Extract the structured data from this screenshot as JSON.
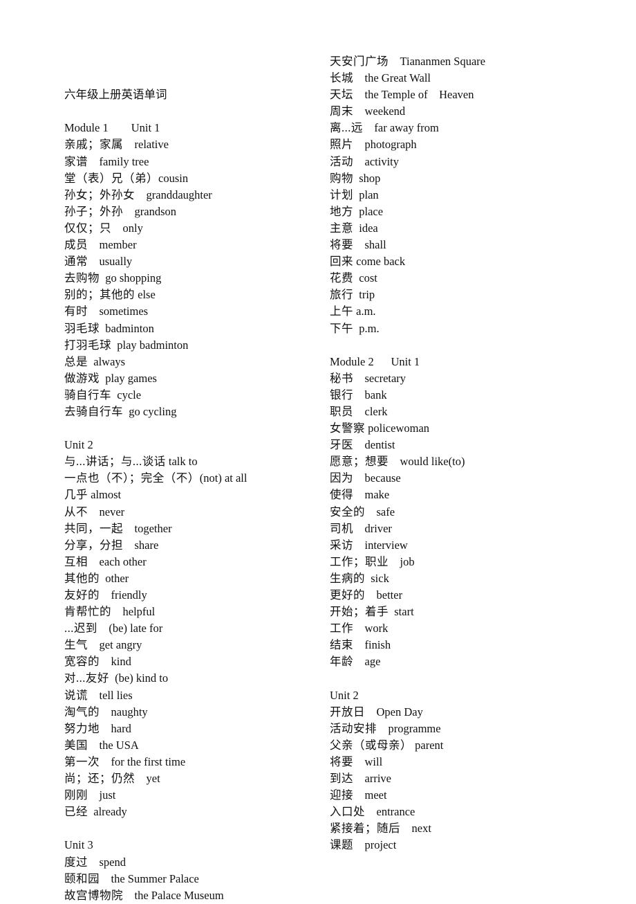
{
  "document": {
    "title": "六年级上册英语单词",
    "left_column": [
      {
        "type": "heading",
        "text": "Module 1        Unit 1"
      },
      {
        "type": "entry",
        "zh": "亲戚；家属",
        "sep": "    ",
        "en": "relative"
      },
      {
        "type": "entry",
        "zh": "家谱",
        "sep": "    ",
        "en": "family tree"
      },
      {
        "type": "entry",
        "zh": "堂（表）兄（弟）",
        "sep": "",
        "en": "cousin"
      },
      {
        "type": "entry",
        "zh": "孙女；外孙女",
        "sep": "    ",
        "en": "granddaughter"
      },
      {
        "type": "entry",
        "zh": "孙子；外孙",
        "sep": "    ",
        "en": "grandson"
      },
      {
        "type": "entry",
        "zh": "仅仅；只",
        "sep": "    ",
        "en": "only"
      },
      {
        "type": "entry",
        "zh": "成员",
        "sep": "    ",
        "en": "member"
      },
      {
        "type": "entry",
        "zh": "通常",
        "sep": "    ",
        "en": "usually"
      },
      {
        "type": "entry",
        "zh": "去购物",
        "sep": "  ",
        "en": "go shopping"
      },
      {
        "type": "entry",
        "zh": "别的；其他的",
        "sep": " ",
        "en": "else"
      },
      {
        "type": "entry",
        "zh": "有时",
        "sep": "    ",
        "en": "sometimes"
      },
      {
        "type": "entry",
        "zh": "羽毛球",
        "sep": "  ",
        "en": "badminton"
      },
      {
        "type": "entry",
        "zh": "打羽毛球",
        "sep": "  ",
        "en": "play badminton"
      },
      {
        "type": "entry",
        "zh": "总是",
        "sep": "  ",
        "en": "always"
      },
      {
        "type": "entry",
        "zh": "做游戏",
        "sep": "  ",
        "en": "play games"
      },
      {
        "type": "entry",
        "zh": "骑自行车",
        "sep": "  ",
        "en": "cycle"
      },
      {
        "type": "entry",
        "zh": "去骑自行车",
        "sep": "  ",
        "en": "go cycling"
      },
      {
        "type": "blank"
      },
      {
        "type": "heading",
        "text": "Unit 2"
      },
      {
        "type": "entry",
        "zh": "与...讲话；与...谈话",
        "sep": " ",
        "en": "talk to"
      },
      {
        "type": "entry",
        "zh": "一点也（不）；完全（不）",
        "sep": "",
        "en": "(not) at all"
      },
      {
        "type": "entry",
        "zh": "几乎",
        "sep": " ",
        "en": "almost"
      },
      {
        "type": "entry",
        "zh": "从不",
        "sep": "    ",
        "en": "never"
      },
      {
        "type": "entry",
        "zh": "共同，一起",
        "sep": "    ",
        "en": "together"
      },
      {
        "type": "entry",
        "zh": "分享，分担",
        "sep": "    ",
        "en": "share"
      },
      {
        "type": "entry",
        "zh": "互相",
        "sep": "    ",
        "en": "each other"
      },
      {
        "type": "entry",
        "zh": "其他的",
        "sep": "  ",
        "en": "other"
      },
      {
        "type": "entry",
        "zh": "友好的",
        "sep": "    ",
        "en": "friendly"
      },
      {
        "type": "entry",
        "zh": "肯帮忙的",
        "sep": "    ",
        "en": "helpful"
      },
      {
        "type": "entry",
        "zh": "...迟到",
        "sep": "    ",
        "en": "(be) late for"
      },
      {
        "type": "entry",
        "zh": "生气",
        "sep": "    ",
        "en": "get angry"
      },
      {
        "type": "entry",
        "zh": "宽容的",
        "sep": "    ",
        "en": "kind"
      },
      {
        "type": "entry",
        "zh": "对...友好",
        "sep": "  ",
        "en": "(be) kind to"
      },
      {
        "type": "entry",
        "zh": "说谎",
        "sep": "    ",
        "en": "tell lies"
      },
      {
        "type": "entry",
        "zh": "淘气的",
        "sep": "    ",
        "en": "naughty"
      },
      {
        "type": "entry",
        "zh": "努力地",
        "sep": "    ",
        "en": "hard"
      },
      {
        "type": "entry",
        "zh": "美国",
        "sep": "    ",
        "en": "the USA"
      },
      {
        "type": "entry",
        "zh": "第一次",
        "sep": "    ",
        "en": "for the first time"
      },
      {
        "type": "entry",
        "zh": "尚；还；仍然",
        "sep": "    ",
        "en": "yet"
      },
      {
        "type": "entry",
        "zh": "刚刚",
        "sep": "    ",
        "en": "just"
      },
      {
        "type": "entry",
        "zh": "已经",
        "sep": "  ",
        "en": "already"
      },
      {
        "type": "blank"
      },
      {
        "type": "heading",
        "text": "Unit 3"
      },
      {
        "type": "entry",
        "zh": "度过",
        "sep": "    ",
        "en": "spend"
      },
      {
        "type": "entry",
        "zh": "颐和园",
        "sep": "    ",
        "en": "the Summer Palace"
      },
      {
        "type": "entry",
        "zh": "故宫博物院",
        "sep": "    ",
        "en": "the Palace Museum"
      }
    ],
    "right_column": [
      {
        "type": "entry",
        "zh": "天安门广场",
        "sep": "    ",
        "en": "Tiananmen Square"
      },
      {
        "type": "entry",
        "zh": "长城",
        "sep": "    ",
        "en": "the Great Wall"
      },
      {
        "type": "entry",
        "zh": "天坛",
        "sep": "    ",
        "en": "the Temple of    Heaven"
      },
      {
        "type": "entry",
        "zh": "周末",
        "sep": "    ",
        "en": "weekend"
      },
      {
        "type": "entry",
        "zh": "离...远",
        "sep": "    ",
        "en": "far away from"
      },
      {
        "type": "entry",
        "zh": "照片",
        "sep": "    ",
        "en": "photograph"
      },
      {
        "type": "entry",
        "zh": "活动",
        "sep": "    ",
        "en": "activity"
      },
      {
        "type": "entry",
        "zh": "购物",
        "sep": "  ",
        "en": "shop"
      },
      {
        "type": "entry",
        "zh": "计划",
        "sep": "  ",
        "en": "plan"
      },
      {
        "type": "entry",
        "zh": "地方",
        "sep": "  ",
        "en": "place"
      },
      {
        "type": "entry",
        "zh": "主意",
        "sep": "  ",
        "en": "idea"
      },
      {
        "type": "entry",
        "zh": "将要",
        "sep": "    ",
        "en": "shall"
      },
      {
        "type": "entry",
        "zh": "回来",
        "sep": " ",
        "en": "come back"
      },
      {
        "type": "entry",
        "zh": "花费",
        "sep": "  ",
        "en": "cost"
      },
      {
        "type": "entry",
        "zh": "旅行",
        "sep": "  ",
        "en": "trip"
      },
      {
        "type": "entry",
        "zh": "上午",
        "sep": " ",
        "en": "a.m."
      },
      {
        "type": "entry",
        "zh": "下午",
        "sep": "  ",
        "en": "p.m."
      },
      {
        "type": "blank"
      },
      {
        "type": "heading",
        "text": "Module 2      Unit 1"
      },
      {
        "type": "entry",
        "zh": "秘书",
        "sep": "    ",
        "en": "secretary"
      },
      {
        "type": "entry",
        "zh": "银行",
        "sep": "    ",
        "en": "bank"
      },
      {
        "type": "entry",
        "zh": "职员",
        "sep": "    ",
        "en": "clerk"
      },
      {
        "type": "entry",
        "zh": "女警察",
        "sep": " ",
        "en": "policewoman"
      },
      {
        "type": "entry",
        "zh": "牙医",
        "sep": "    ",
        "en": "dentist"
      },
      {
        "type": "entry",
        "zh": "愿意；想要",
        "sep": "    ",
        "en": "would like(to)"
      },
      {
        "type": "entry",
        "zh": "因为",
        "sep": "    ",
        "en": "because"
      },
      {
        "type": "entry",
        "zh": "使得",
        "sep": "    ",
        "en": "make"
      },
      {
        "type": "entry",
        "zh": "安全的",
        "sep": "    ",
        "en": "safe"
      },
      {
        "type": "entry",
        "zh": "司机",
        "sep": "    ",
        "en": "driver"
      },
      {
        "type": "entry",
        "zh": "采访",
        "sep": "    ",
        "en": "interview"
      },
      {
        "type": "entry",
        "zh": "工作；职业",
        "sep": "    ",
        "en": "job"
      },
      {
        "type": "entry",
        "zh": "生病的",
        "sep": "  ",
        "en": "sick"
      },
      {
        "type": "entry",
        "zh": "更好的",
        "sep": "    ",
        "en": "better"
      },
      {
        "type": "entry",
        "zh": "开始；着手",
        "sep": "  ",
        "en": "start"
      },
      {
        "type": "entry",
        "zh": "工作",
        "sep": "    ",
        "en": "work"
      },
      {
        "type": "entry",
        "zh": "结束",
        "sep": "    ",
        "en": "finish"
      },
      {
        "type": "entry",
        "zh": "年龄",
        "sep": "    ",
        "en": "age"
      },
      {
        "type": "blank"
      },
      {
        "type": "heading",
        "text": "Unit 2"
      },
      {
        "type": "entry",
        "zh": "开放日",
        "sep": "    ",
        "en": "Open Day"
      },
      {
        "type": "entry",
        "zh": "活动安排",
        "sep": "    ",
        "en": "programme"
      },
      {
        "type": "entry",
        "zh": "父亲（或母亲）",
        "sep": " ",
        "en": "parent"
      },
      {
        "type": "entry",
        "zh": "将要",
        "sep": "    ",
        "en": "will"
      },
      {
        "type": "entry",
        "zh": "到达",
        "sep": "    ",
        "en": "arrive"
      },
      {
        "type": "entry",
        "zh": "迎接",
        "sep": "    ",
        "en": "meet"
      },
      {
        "type": "entry",
        "zh": "入口处",
        "sep": "    ",
        "en": "entrance"
      },
      {
        "type": "entry",
        "zh": "紧接着；随后",
        "sep": "    ",
        "en": "next"
      },
      {
        "type": "entry",
        "zh": "课题",
        "sep": "    ",
        "en": "project"
      }
    ]
  }
}
